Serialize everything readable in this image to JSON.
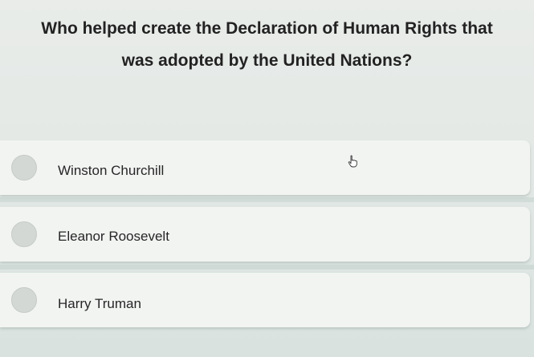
{
  "question": {
    "line1": "Who helped create the Declaration of Human Rights that",
    "line2": "was adopted by the United Nations?"
  },
  "options": [
    {
      "label": "Winston Churchill"
    },
    {
      "label": "Eleanor Roosevelt"
    },
    {
      "label": "Harry Truman"
    }
  ],
  "cursor_icon": "hand-pointer-icon"
}
